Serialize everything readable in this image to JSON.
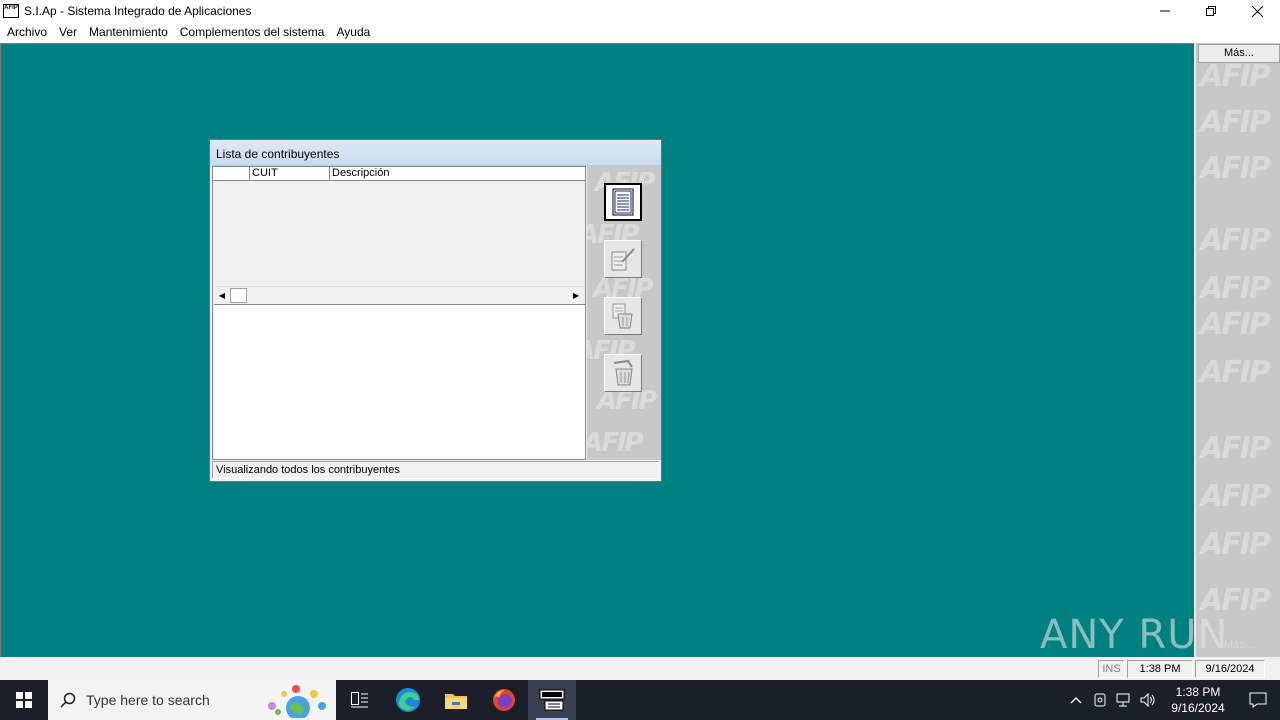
{
  "window": {
    "title": "S.I.Ap - Sistema Integrado de Aplicaciones",
    "icon_text": "AFIP",
    "controls": {
      "minimize": "—",
      "restore": "❐",
      "close": "✕"
    }
  },
  "menu": [
    "Archivo",
    "Ver",
    "Mantenimiento",
    "Complementos del sistema",
    "Ayuda"
  ],
  "right_panel": {
    "more_button": "Más...",
    "more_button_bottom": "Más...",
    "watermark_text": "AFIP"
  },
  "child_window": {
    "title": "Lista de contribuyentes",
    "columns": [
      "",
      "CUIT",
      "Descripción"
    ],
    "rows": [],
    "status": "Visualizando todos los contribuyentes",
    "tool_buttons": [
      "list-view",
      "edit",
      "delete-selected",
      "delete-all"
    ]
  },
  "status_bar": {
    "ins": "INS",
    "time": "1:38 PM",
    "date": "9/16/2024"
  },
  "watermark": "ANY RUN",
  "taskbar": {
    "search_placeholder": "Type here to search",
    "clock_time": "1:38 PM",
    "clock_date": "9/16/2024",
    "apps": [
      "task-view",
      "edge",
      "file-explorer",
      "firefox",
      "siap"
    ]
  },
  "colors": {
    "mdi_background": "#008080",
    "panel_gray": "#c8c8c8",
    "taskbar": "#1b1f2a"
  }
}
